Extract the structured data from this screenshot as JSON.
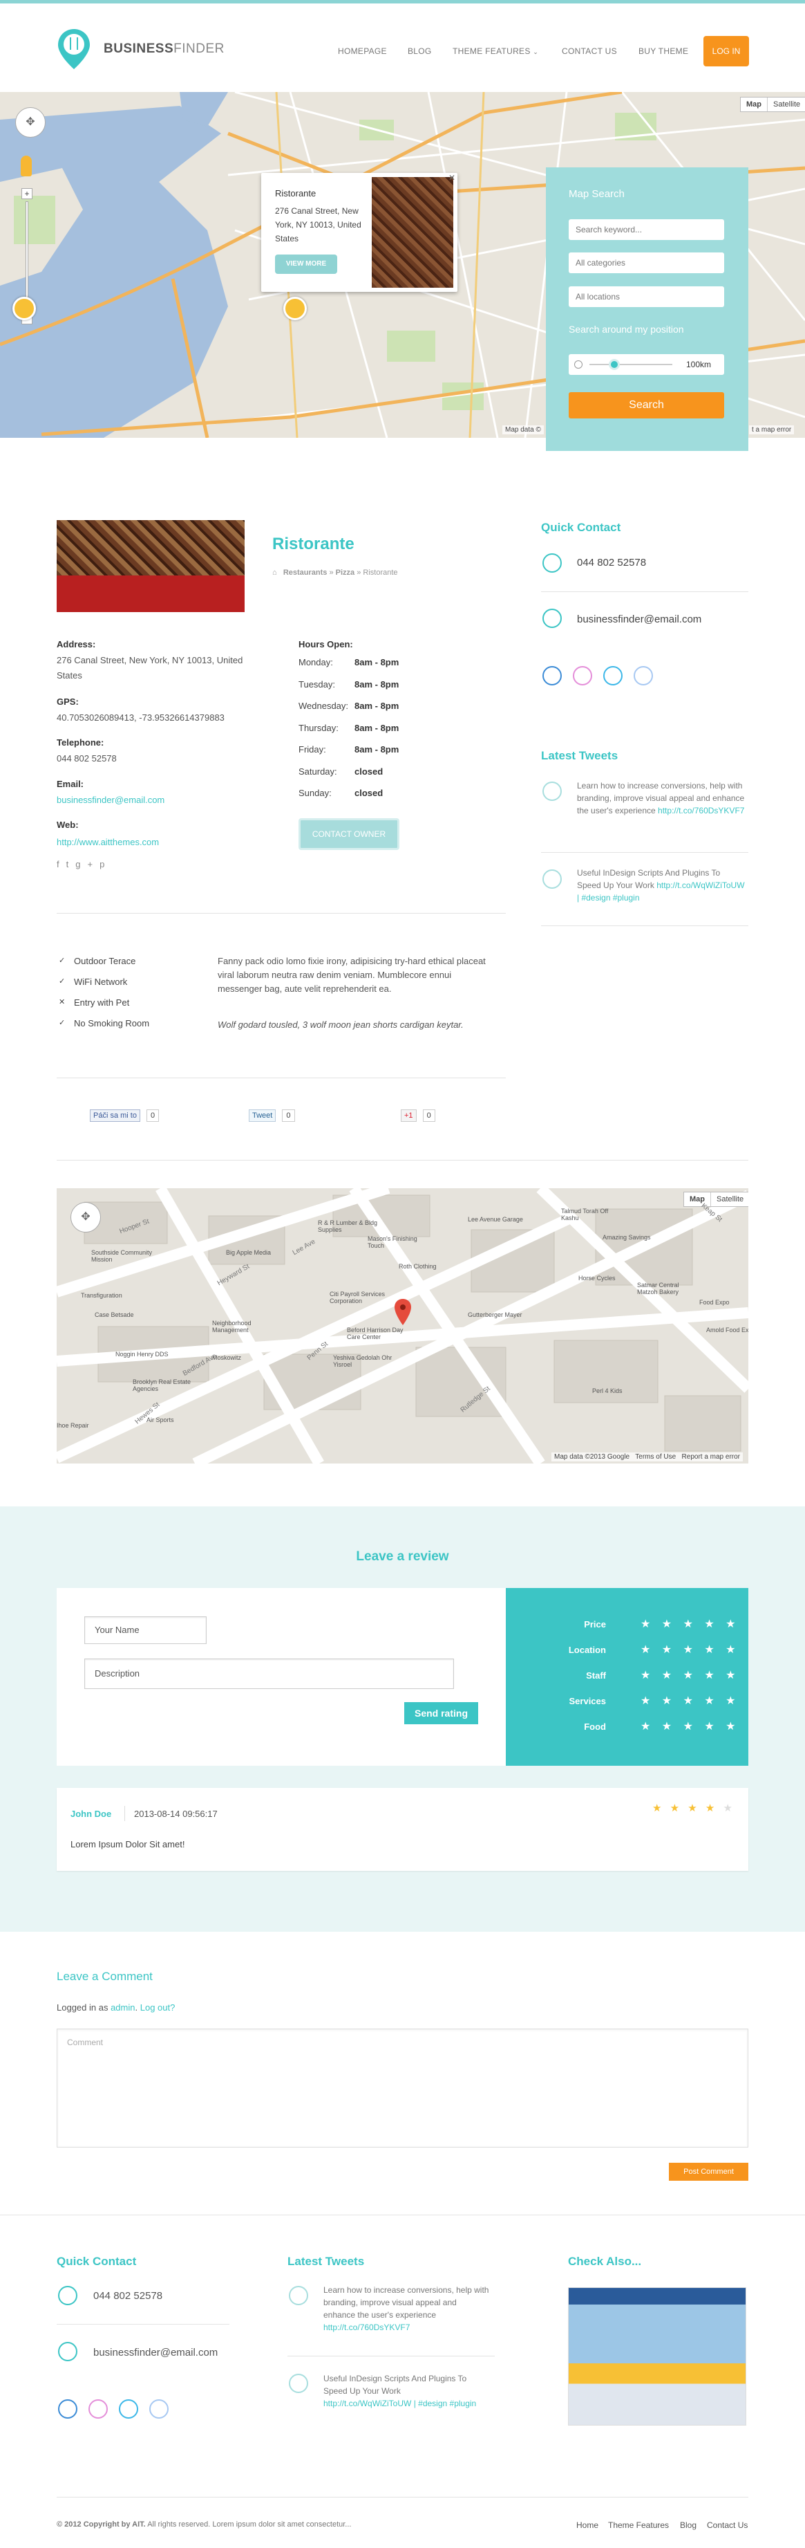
{
  "brand": {
    "name_bold": "BUSINESS",
    "name_light": "FINDER"
  },
  "nav": [
    "HOMEPAGE",
    "BLOG",
    "THEME FEATURES",
    "CONTACT US",
    "BUY THEME"
  ],
  "login_label": "LOG IN",
  "map_top": {
    "map_label": "Map",
    "satellite_label": "Satellite",
    "footer": "Map data ©",
    "report": "t a map error",
    "infowindow": {
      "title": "Ristorante",
      "address": "276 Canal Street, New York, NY 10013, United States",
      "button": "VIEW MORE"
    }
  },
  "map_search": {
    "title": "Map Search",
    "keyword_placeholder": "Search keyword...",
    "categories": "All categories",
    "locations": "All locations",
    "around": "Search around my position",
    "radius": "100km",
    "radius_value_fraction": 0.22,
    "button": "Search"
  },
  "listing": {
    "title": "Ristorante",
    "breadcrumb": [
      "Restaurants",
      "Pizza",
      "Ristorante"
    ],
    "address_label": "Address:",
    "address": "276 Canal Street, New York, NY 10013, United States",
    "gps_label": "GPS:",
    "gps": "40.7053026089413, -73.95326614379883",
    "telephone_label": "Telephone:",
    "telephone": "044 802 52578",
    "email_label": "Email:",
    "email": "businessfinder@email.com",
    "web_label": "Web:",
    "web": "http://www.aitthemes.com",
    "hours_label": "Hours Open:",
    "hours": [
      {
        "day": "Monday:",
        "time": "8am - 8pm"
      },
      {
        "day": "Tuesday:",
        "time": "8am - 8pm"
      },
      {
        "day": "Wednesday:",
        "time": "8am - 8pm"
      },
      {
        "day": "Thursday:",
        "time": "8am - 8pm"
      },
      {
        "day": "Friday:",
        "time": "8am - 8pm"
      },
      {
        "day": "Saturday:",
        "time": "closed"
      },
      {
        "day": "Sunday:",
        "time": "closed"
      }
    ],
    "contact_owner": "CONTACT OWNER",
    "features": [
      {
        "mark": "✓",
        "label": "Outdoor Terace"
      },
      {
        "mark": "✓",
        "label": "WiFi Network"
      },
      {
        "mark": "✕",
        "label": "Entry with Pet"
      },
      {
        "mark": "✓",
        "label": "No Smoking Room"
      }
    ],
    "description": "Fanny pack odio lomo fixie irony, adipisicing try-hard ethical placeat viral laborum neutra raw denim veniam. Mumblecore ennui messenger bag, aute velit reprehenderit ea.",
    "quote": "Wolf godard tousled, 3 wolf moon jean shorts cardigan keytar.",
    "share": {
      "fb": "Páči sa mi to",
      "fb_count": "0",
      "tw": "Tweet",
      "tw_count": "0",
      "gp": "+1",
      "gp_count": "0"
    }
  },
  "quick_contact": {
    "title": "Quick Contact",
    "phone": "044 802 52578",
    "email": "businessfinder@email.com"
  },
  "latest_tweets": {
    "title": "Latest Tweets",
    "items": [
      {
        "text": "Learn how to increase conversions, help with branding, improve visual appeal and enhance the user's experience",
        "link": "http://t.co/760DsYKVF7"
      },
      {
        "text": "Useful InDesign Scripts And Plugins To Speed Up Your Work",
        "link": "http://t.co/WqWiZiToUW",
        "tags": "| #design #plugin"
      }
    ],
    "footer_items": [
      {
        "text": "Learn how to increase conversions, help with branding, improve visual appeal and enhance the user's experience",
        "link": "http://t.co/760DsYKVF7"
      },
      {
        "text": "Useful InDesign Scripts And Plugins To Speed Up Your Work",
        "link": "http://t.co/WqWiZiToUW",
        "tags": "| #design #plugin"
      }
    ]
  },
  "map_bottom": {
    "map_label": "Map",
    "satellite_label": "Satellite",
    "footer": "Map data ©2013 Google",
    "terms": "Terms of Use",
    "report": "Report a map error",
    "places": [
      "R & R Lumber & Bldg Supplies",
      "Big Apple Media",
      "Mason's Finishing Touch",
      "Lee Avenue Garage",
      "Talmud Torah Off Kashu",
      "Amazing Savings",
      "Roth Clothing",
      "Southside Community Mission",
      "Horse Cycles",
      "Satmar Central Matzoh Bakery",
      "Transfiguration",
      "Citi Payroll Services Corporation",
      "Gutterberger Mayer",
      "Food Expo",
      "Neighborhood Management",
      "Beford Harrison Day Care Center",
      "Amold Food Exp",
      "Case Betsade",
      "Noggin Henry DDS",
      "Yeshiva Gedolah Ohr Yisroel",
      "Moskowitz",
      "Brooklyn Real Estate Agencies",
      "Perl 4 Kids",
      "Air Sports",
      "Ihoe Repair"
    ],
    "streets": [
      "Hooper St",
      "Heyward St",
      "Penn St",
      "Rutledge St",
      "Hewes St",
      "Bedford Ave",
      "Lee Ave",
      "Keap St"
    ]
  },
  "review": {
    "title": "Leave a review",
    "name_placeholder": "Your Name",
    "desc_placeholder": "Description",
    "send": "Send rating",
    "criteria": [
      "Price",
      "Location",
      "Staff",
      "Services",
      "Food"
    ],
    "star_glyph": "★ ★ ★ ★ ★",
    "existing": {
      "author": "John Doe",
      "date": "2013-08-14 09:56:17",
      "text": "Lorem Ipsum Dolor Sit amet!",
      "rating": 4,
      "stars_on": "★ ★ ★ ★",
      "stars_off": "★"
    }
  },
  "comment": {
    "title": "Leave a Comment",
    "logged_prefix": "Logged in as",
    "user": "admin",
    "logout": "Log out?",
    "placeholder": "Comment",
    "post": "Post Comment"
  },
  "check_also": {
    "title": "Check Also..."
  },
  "footer": {
    "copyright_bold": "© 2012 Copyright by AIT.",
    "copyright": "All rights reserved. Lorem ipsum dolor sit amet consectetur...",
    "links": [
      "Home",
      "Theme Features",
      "Blog",
      "Contact Us"
    ]
  },
  "colors": {
    "accent": "#3cc5c5",
    "orange": "#f7941d",
    "panel": "#9fdcdc",
    "band": "#e8f5f5"
  }
}
